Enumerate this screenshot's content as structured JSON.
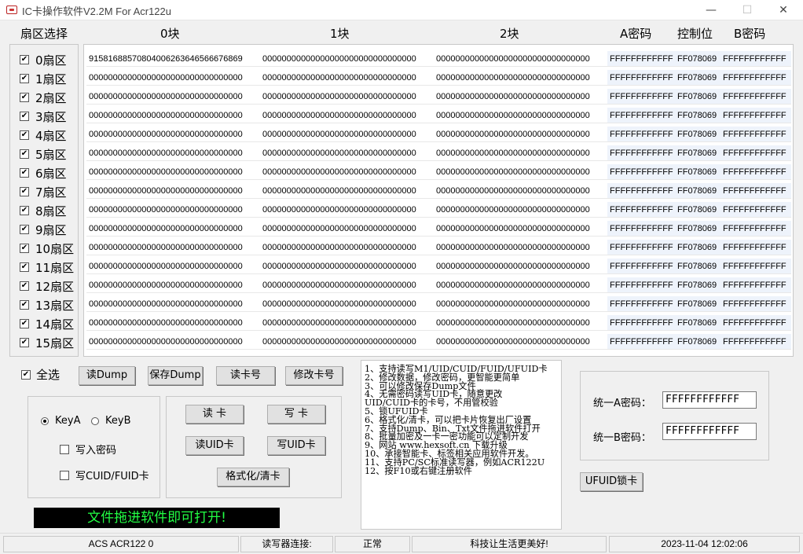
{
  "window": {
    "title": "IC卡操作软件V2.2M For Acr122u",
    "minimize": "—",
    "maximize": "☐",
    "close": "✕"
  },
  "headers": {
    "sector_select": "扇区选择",
    "block0": "0块",
    "block1": "1块",
    "block2": "2块",
    "key_a": "A密码",
    "control": "控制位",
    "key_b": "B密码"
  },
  "sectors": [
    {
      "label": "0扇区",
      "checked": true,
      "block0": "91581688570804006263646566676869",
      "block1": "00000000000000000000000000000000",
      "block2": "00000000000000000000000000000000",
      "key_a": "FFFFFFFFFFFF",
      "control": "FF078069",
      "key_b": "FFFFFFFFFFFF"
    },
    {
      "label": "1扇区",
      "checked": true,
      "block0": "00000000000000000000000000000000",
      "block1": "00000000000000000000000000000000",
      "block2": "00000000000000000000000000000000",
      "key_a": "FFFFFFFFFFFF",
      "control": "FF078069",
      "key_b": "FFFFFFFFFFFF"
    },
    {
      "label": "2扇区",
      "checked": true,
      "block0": "00000000000000000000000000000000",
      "block1": "00000000000000000000000000000000",
      "block2": "00000000000000000000000000000000",
      "key_a": "FFFFFFFFFFFF",
      "control": "FF078069",
      "key_b": "FFFFFFFFFFFF"
    },
    {
      "label": "3扇区",
      "checked": true,
      "block0": "00000000000000000000000000000000",
      "block1": "00000000000000000000000000000000",
      "block2": "00000000000000000000000000000000",
      "key_a": "FFFFFFFFFFFF",
      "control": "FF078069",
      "key_b": "FFFFFFFFFFFF"
    },
    {
      "label": "4扇区",
      "checked": true,
      "block0": "00000000000000000000000000000000",
      "block1": "00000000000000000000000000000000",
      "block2": "00000000000000000000000000000000",
      "key_a": "FFFFFFFFFFFF",
      "control": "FF078069",
      "key_b": "FFFFFFFFFFFF"
    },
    {
      "label": "5扇区",
      "checked": true,
      "block0": "00000000000000000000000000000000",
      "block1": "00000000000000000000000000000000",
      "block2": "00000000000000000000000000000000",
      "key_a": "FFFFFFFFFFFF",
      "control": "FF078069",
      "key_b": "FFFFFFFFFFFF"
    },
    {
      "label": "6扇区",
      "checked": true,
      "block0": "00000000000000000000000000000000",
      "block1": "00000000000000000000000000000000",
      "block2": "00000000000000000000000000000000",
      "key_a": "FFFFFFFFFFFF",
      "control": "FF078069",
      "key_b": "FFFFFFFFFFFF"
    },
    {
      "label": "7扇区",
      "checked": true,
      "block0": "00000000000000000000000000000000",
      "block1": "00000000000000000000000000000000",
      "block2": "00000000000000000000000000000000",
      "key_a": "FFFFFFFFFFFF",
      "control": "FF078069",
      "key_b": "FFFFFFFFFFFF"
    },
    {
      "label": "8扇区",
      "checked": true,
      "block0": "00000000000000000000000000000000",
      "block1": "00000000000000000000000000000000",
      "block2": "00000000000000000000000000000000",
      "key_a": "FFFFFFFFFFFF",
      "control": "FF078069",
      "key_b": "FFFFFFFFFFFF"
    },
    {
      "label": "9扇区",
      "checked": true,
      "block0": "00000000000000000000000000000000",
      "block1": "00000000000000000000000000000000",
      "block2": "00000000000000000000000000000000",
      "key_a": "FFFFFFFFFFFF",
      "control": "FF078069",
      "key_b": "FFFFFFFFFFFF"
    },
    {
      "label": "10扇区",
      "checked": true,
      "block0": "00000000000000000000000000000000",
      "block1": "00000000000000000000000000000000",
      "block2": "00000000000000000000000000000000",
      "key_a": "FFFFFFFFFFFF",
      "control": "FF078069",
      "key_b": "FFFFFFFFFFFF"
    },
    {
      "label": "11扇区",
      "checked": true,
      "block0": "00000000000000000000000000000000",
      "block1": "00000000000000000000000000000000",
      "block2": "00000000000000000000000000000000",
      "key_a": "FFFFFFFFFFFF",
      "control": "FF078069",
      "key_b": "FFFFFFFFFFFF"
    },
    {
      "label": "12扇区",
      "checked": true,
      "block0": "00000000000000000000000000000000",
      "block1": "00000000000000000000000000000000",
      "block2": "00000000000000000000000000000000",
      "key_a": "FFFFFFFFFFFF",
      "control": "FF078069",
      "key_b": "FFFFFFFFFFFF"
    },
    {
      "label": "13扇区",
      "checked": true,
      "block0": "00000000000000000000000000000000",
      "block1": "00000000000000000000000000000000",
      "block2": "00000000000000000000000000000000",
      "key_a": "FFFFFFFFFFFF",
      "control": "FF078069",
      "key_b": "FFFFFFFFFFFF"
    },
    {
      "label": "14扇区",
      "checked": true,
      "block0": "00000000000000000000000000000000",
      "block1": "00000000000000000000000000000000",
      "block2": "00000000000000000000000000000000",
      "key_a": "FFFFFFFFFFFF",
      "control": "FF078069",
      "key_b": "FFFFFFFFFFFF"
    },
    {
      "label": "15扇区",
      "checked": true,
      "block0": "00000000000000000000000000000000",
      "block1": "00000000000000000000000000000000",
      "block2": "00000000000000000000000000000000",
      "key_a": "FFFFFFFFFFFF",
      "control": "FF078069",
      "key_b": "FFFFFFFFFFFF"
    }
  ],
  "select_all": {
    "label": "全选",
    "checked": true
  },
  "toolbar": {
    "read_dump": "读Dump",
    "save_dump": "保存Dump",
    "read_card_no": "读卡号",
    "edit_card_no": "修改卡号"
  },
  "key_options": {
    "key_a": "KeyA",
    "key_b": "KeyB",
    "selected": "KeyA",
    "write_password": "写入密码",
    "write_cuid_fuid": "写CUID/FUID卡"
  },
  "actions": {
    "read_card": "读 卡",
    "write_card": "写 卡",
    "read_uid": "读UID卡",
    "write_uid": "写UID卡",
    "format_clear": "格式化/清卡"
  },
  "info_lines": [
    "1、支持读写M1/UID/CUID/FUID/UFUID卡",
    "2、修改数据，修改密码，更智能更简单",
    "3、可以修改保存Dump文件",
    "4、无需密码读写UID卡，随意更改",
    "   UID/CUID卡的卡号，不用管校验",
    "5、锁UFUID卡",
    "6、格式化/清卡，可以把卡片恢复出厂设置",
    "7、支持Dump、Bin、Txt文件拖进软件打开",
    "8、批量加密及一卡一密功能可以定制开发",
    "9、网站 www.hexsoft.cn 下载升级",
    "10、承接智能卡、标签相关应用软件开发。",
    "11、支持PC/SC标准读写器，例如ACR122U",
    "12、按F10或右键注册软件"
  ],
  "banner": "文件拖进软件即可打开!",
  "unified_keys": {
    "a_label": "统一A密码：",
    "a_value": "FFFFFFFFFFFF",
    "b_label": "统一B密码：",
    "b_value": "FFFFFFFFFFFF"
  },
  "ufuid_lock": "UFUID锁卡",
  "status": {
    "reader": "ACS ACR122 0",
    "connect_label": "读写器连接:",
    "connect_state": "正常",
    "slogan": "科技让生活更美好!",
    "datetime": "2023-11-04 12:02:06"
  },
  "colors": {
    "banner_bg": "#000000",
    "banner_text": "#22ff44",
    "key_cell_bg": "#eef3fb"
  }
}
